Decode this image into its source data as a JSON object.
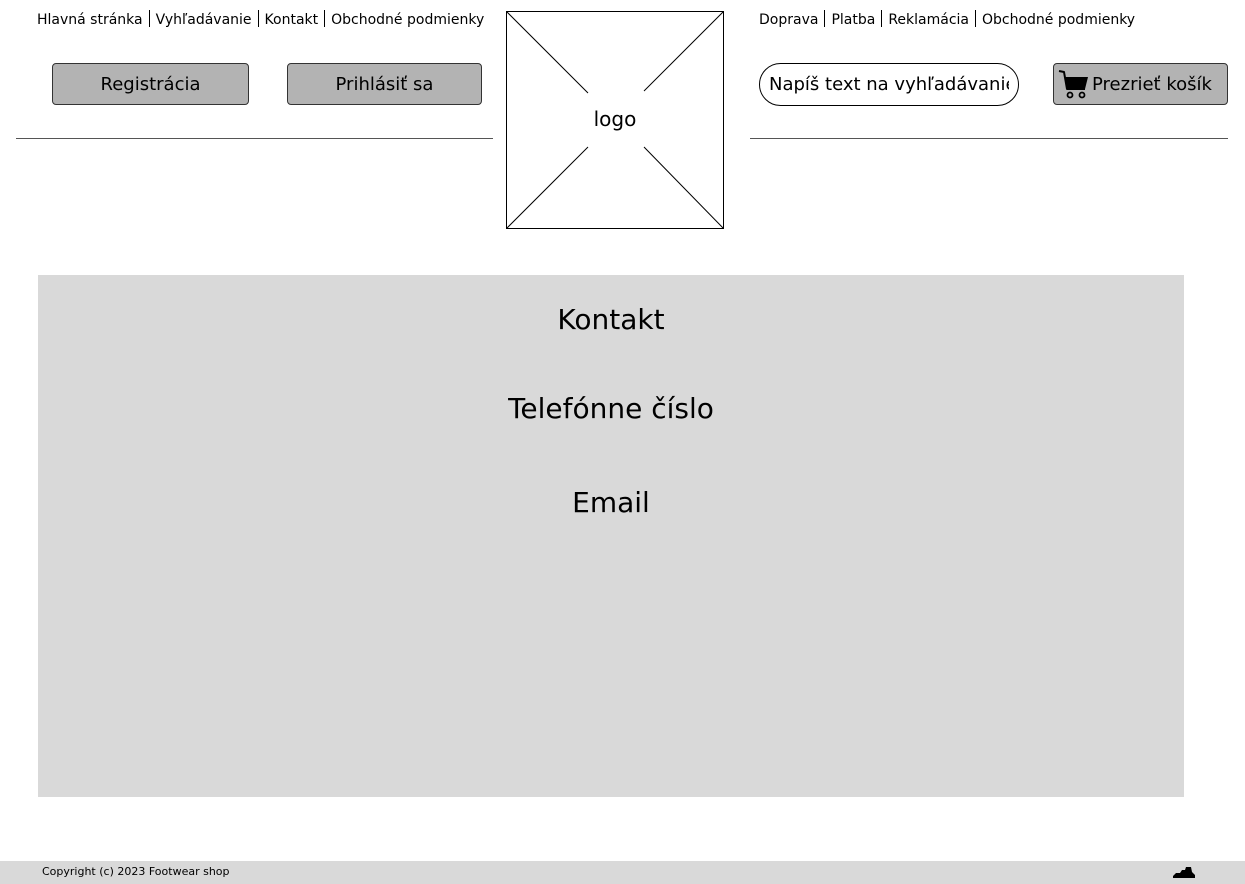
{
  "nav_left": {
    "items": [
      "Hlavná stránka",
      "Vyhľadávanie",
      "Kontakt",
      "Obchodné podmienky"
    ]
  },
  "nav_right": {
    "items": [
      "Doprava",
      "Platba",
      "Reklamácia",
      "Obchodné podmienky"
    ]
  },
  "buttons": {
    "register": "Registrácia",
    "login": "Prihlásiť sa",
    "cart": "Prezrieť košík"
  },
  "search": {
    "placeholder": "Napíš text na vyhľadávanie ..."
  },
  "logo": {
    "text": "logo"
  },
  "main": {
    "title": "Kontakt",
    "phone_label": "Telefónne číslo",
    "email_label": "Email"
  },
  "footer": {
    "copyright": "Copyright (c) 2023 Footwear shop"
  },
  "icons": {
    "cart": "cart-icon",
    "shoe": "shoe-icon"
  },
  "colors": {
    "button_bg": "#b3b3b3",
    "panel_bg": "#d9d9d9",
    "footer_bg": "#d9d9d9"
  }
}
